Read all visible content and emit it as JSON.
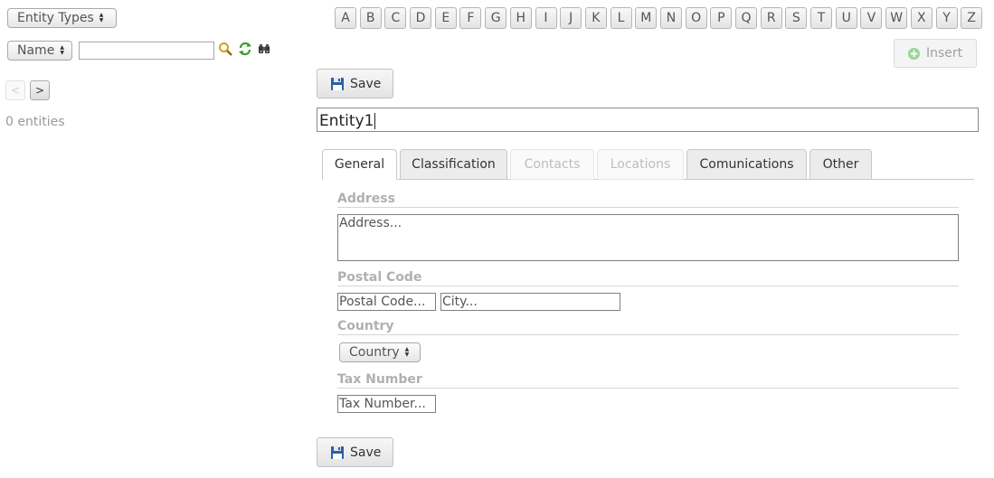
{
  "filters": {
    "entity_types_select": "Entity Types",
    "field_select": "Name",
    "search_value": ""
  },
  "alphabet": [
    "A",
    "B",
    "C",
    "D",
    "E",
    "F",
    "G",
    "H",
    "I",
    "J",
    "K",
    "L",
    "M",
    "N",
    "O",
    "P",
    "Q",
    "R",
    "S",
    "T",
    "U",
    "V",
    "W",
    "X",
    "Y",
    "Z"
  ],
  "pager": {
    "prev": "<",
    "next": ">"
  },
  "entities_count": "0 entities",
  "toolbar": {
    "insert_label": "Insert",
    "save_label": "Save"
  },
  "entity": {
    "name": "Entity1"
  },
  "tabs": [
    {
      "label": "General",
      "state": "active"
    },
    {
      "label": "Classification",
      "state": "normal"
    },
    {
      "label": "Contacts",
      "state": "disabled"
    },
    {
      "label": "Locations",
      "state": "disabled"
    },
    {
      "label": "Comunications",
      "state": "normal"
    },
    {
      "label": "Other",
      "state": "normal"
    }
  ],
  "general": {
    "address_label": "Address",
    "address_placeholder": "Address...",
    "postal_code_label": "Postal Code",
    "postal_code_placeholder": "Postal Code...",
    "city_placeholder": "City...",
    "country_label": "Country",
    "country_select": "Country",
    "tax_number_label": "Tax Number",
    "tax_number_placeholder": "Tax Number..."
  },
  "colors": {
    "search_icon": "#d4a017",
    "refresh_icon": "#3a9a2a",
    "insert_icon": "#9bd59b",
    "save_icon": "#2a5fa8"
  }
}
